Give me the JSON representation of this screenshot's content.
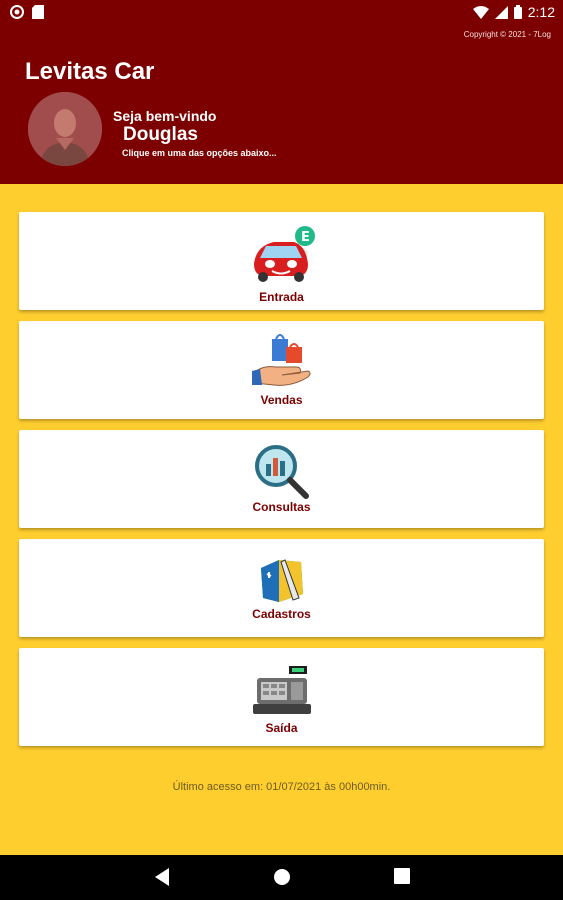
{
  "statusbar": {
    "time": "2:12"
  },
  "header": {
    "copyright": "Copyright © 2021 - 7Log",
    "app_title": "Levitas Car",
    "welcome": "Seja bem-vindo",
    "username": "Douglas",
    "hint": "Clique em uma das opções abaixo..."
  },
  "menu": {
    "items": [
      {
        "label": "Entrada",
        "icon": "car-entry-icon"
      },
      {
        "label": "Vendas",
        "icon": "shopping-hand-icon"
      },
      {
        "label": "Consultas",
        "icon": "magnifier-chart-icon"
      },
      {
        "label": "Cadastros",
        "icon": "folder-pen-icon"
      },
      {
        "label": "Saída",
        "icon": "cash-register-icon"
      }
    ]
  },
  "footer": {
    "last_access": "Último acesso em: 01/07/2021 às 00h00min."
  },
  "colors": {
    "header": "#7d0000",
    "background": "#fece2f",
    "label": "#7d0000"
  }
}
